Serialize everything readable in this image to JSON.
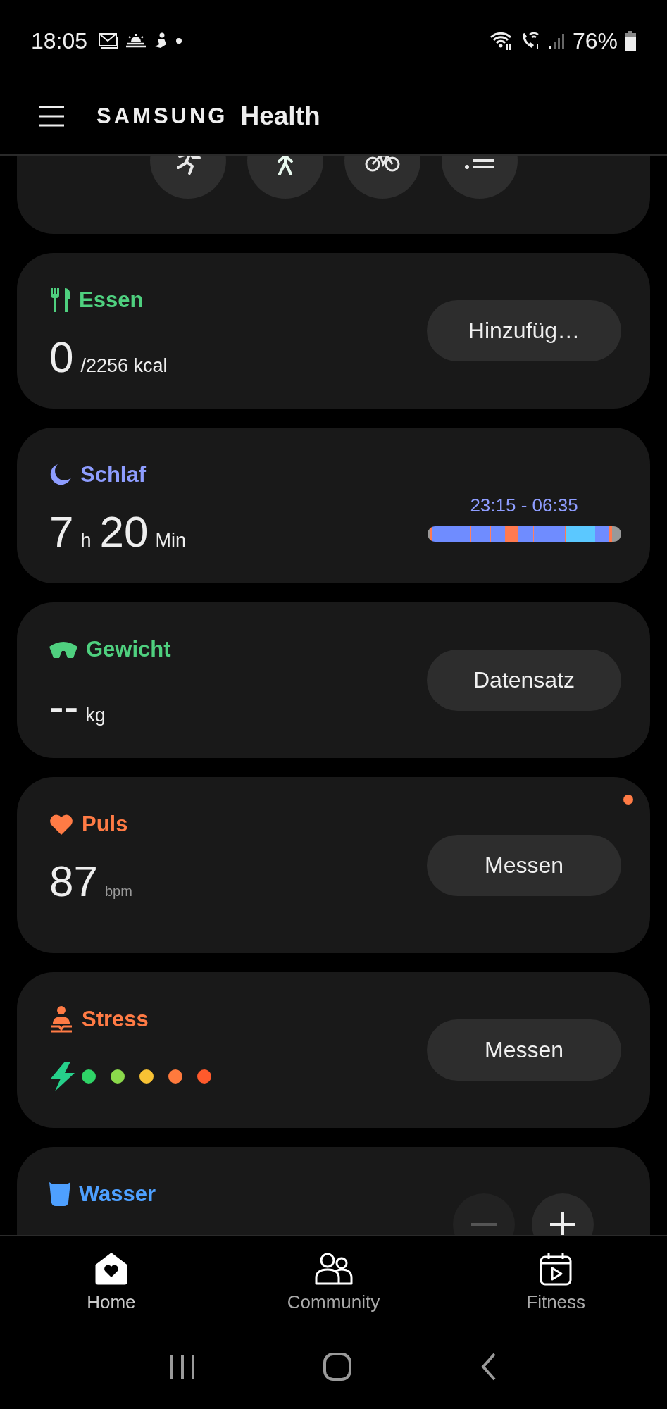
{
  "status_bar": {
    "time": "18:05",
    "battery": "76%"
  },
  "header": {
    "brand": "SAMSUNG",
    "app": "Health"
  },
  "exercise_shortcuts": [
    {
      "kind": "running"
    },
    {
      "kind": "walking"
    },
    {
      "kind": "cycling"
    },
    {
      "kind": "list"
    }
  ],
  "cards": [
    {
      "kind": "food",
      "title": "Essen",
      "color": "#4fd07f",
      "notification": false,
      "values": [
        {
          "kind": "number",
          "text": "0"
        },
        {
          "kind": "unit",
          "text": "/2256 kcal"
        }
      ],
      "button": "Hinzufüg…"
    },
    {
      "kind": "sleep",
      "title": "Schlaf",
      "color": "#8e9dff",
      "notification": false,
      "values": [
        {
          "kind": "number",
          "text": "7"
        },
        {
          "kind": "unit",
          "text": "h"
        },
        {
          "kind": "number",
          "text": "20"
        },
        {
          "kind": "unit",
          "text": "Min"
        }
      ],
      "time_range": "23:15 - 06:35"
    },
    {
      "kind": "weight",
      "title": "Gewicht",
      "color": "#4fd07f",
      "notification": false,
      "values": [
        {
          "kind": "number",
          "text": "--"
        },
        {
          "kind": "unit",
          "text": "kg"
        }
      ],
      "button": "Datensatz"
    },
    {
      "kind": "heart",
      "title": "Puls",
      "color": "#ff7b45",
      "notification": true,
      "values": [
        {
          "kind": "number",
          "text": "87"
        },
        {
          "kind": "small-unit",
          "text": "bpm"
        }
      ],
      "button": "Messen"
    },
    {
      "kind": "stress",
      "title": "Stress",
      "color": "#ff7b45",
      "notification": false,
      "levels": [
        {
          "color": "#2fd467"
        },
        {
          "color": "#8bd94b"
        },
        {
          "color": "#f8c234"
        },
        {
          "color": "#ff7a3d"
        },
        {
          "color": "#ff5a2c"
        }
      ],
      "button": "Messen"
    },
    {
      "kind": "water",
      "title": "Wasser",
      "color": "#4ea0ff",
      "notification": false,
      "controls": [
        {
          "kind": "minus",
          "disabled": true
        },
        {
          "kind": "plus",
          "disabled": false
        }
      ]
    }
  ],
  "bottom_nav": [
    {
      "kind": "home",
      "label": "Home",
      "selected": true
    },
    {
      "kind": "community",
      "label": "Community",
      "selected": false
    },
    {
      "kind": "fitness",
      "label": "Fitness",
      "selected": false
    }
  ]
}
